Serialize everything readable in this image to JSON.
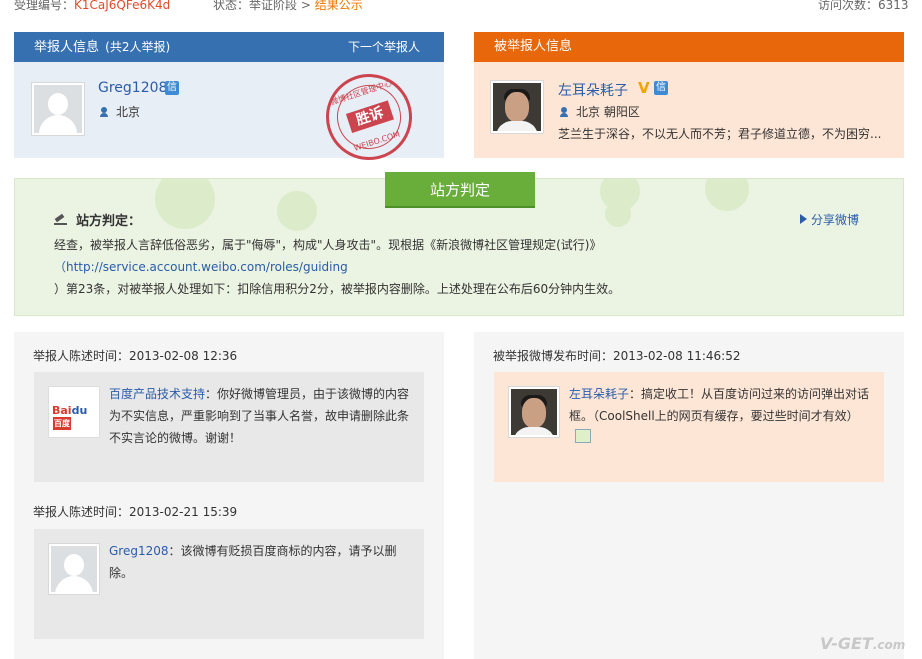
{
  "topbar": {
    "case_label": "受理编号：",
    "case_id": "K1CaJ6QFe6K4d",
    "status_label": "状态：",
    "status_stage": "举证阶段",
    "status_sep": " > ",
    "status_current": "结果公示",
    "visits_label": "访问次数：",
    "visits": "6313"
  },
  "reporter_panel": {
    "title": "举报人信息",
    "count": "(共2人举报)",
    "next": "下一个举报人",
    "name": "Greg1208",
    "badge": "信",
    "location": "北京",
    "stamp": {
      "top_text": "微博社区管理中心",
      "mid_text": "胜诉",
      "bottom_text": "WEIBO.COM"
    }
  },
  "reported_panel": {
    "title": "被举报人信息",
    "name": "左耳朵耗子",
    "v_badge": "V",
    "badge": "信",
    "location": "北京 朝阳区",
    "bio": "芝兰生于深谷，不以无人而不芳；君子修道立德，不为困穷..."
  },
  "judgement": {
    "tab": "站方判定",
    "title": "站方判定：",
    "share": "分享微博",
    "text_1": "经查，被举报人言辞低俗恶劣，属于\"侮辱\"，构成\"人身攻击\"。现根据《新浪微博社区管理规定(试行)》",
    "link": "（http://service.account.weibo.com/roles/guiding",
    "text_2": "）第23条，对被举报人处理如下：扣除信用积分2分，被举报内容删除。上述处理在公布后60分钟内生效。"
  },
  "statements": [
    {
      "time_label": "举报人陈述时间：",
      "time": "2013-02-08 12:36",
      "author": "百度产品技术支持",
      "colon": "：",
      "text": "你好微博管理员，由于该微博的内容为不实信息，严重影响到了当事人名誉，故申请删除此条不实言论的微博。谢谢！",
      "logo_text": "Bai",
      "logo_paw": "du",
      "logo_cn": "百度"
    },
    {
      "time_label": "举报人陈述时间：",
      "time": "2013-02-21 15:39",
      "author": "Greg1208",
      "colon": "：",
      "text": "该微博有贬损百度商标的内容，请予以删除。"
    }
  ],
  "reported_post": {
    "time_label": "被举报微博发布时间：",
    "time": "2013-02-08 11:46:52",
    "author": "左耳朵耗子",
    "colon": "：",
    "text": "搞定收工！从百度访问过来的访问弹出对话框。（CoolShell上的网页有缓存，要过些时间才有效）"
  },
  "watermark": {
    "brand": "V-GET",
    "domain": ".com"
  },
  "colors": {
    "blue_header": "#3670b0",
    "orange_header": "#e8670b",
    "green_tab": "#69ad3b",
    "link": "#2a5caa",
    "stamp_red": "#c8323c"
  },
  "icons": [
    "location-pin-icon",
    "gavel-icon",
    "share-icon",
    "image-icon",
    "verified-icon",
    "v-icon"
  ]
}
